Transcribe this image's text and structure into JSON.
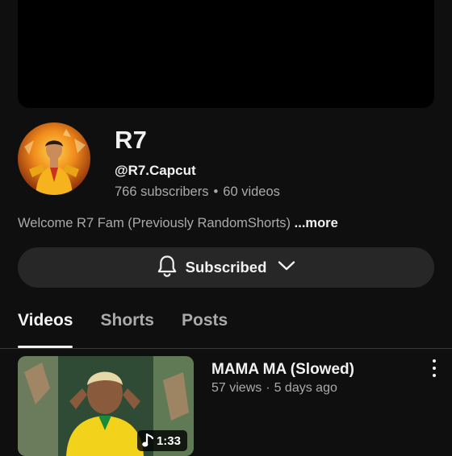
{
  "channel": {
    "name": "R7",
    "handle": "@R7.Capcut",
    "subscribers": "766 subscribers",
    "videos_count": "60 videos",
    "separator": "•",
    "description": "Welcome R7 Fam (Previously RandomShorts)",
    "more_label": "...more"
  },
  "subscribe": {
    "label": "Subscribed",
    "icon": "bell-icon",
    "dropdown_icon": "chevron-down-icon"
  },
  "tabs": [
    {
      "label": "Videos",
      "active": true
    },
    {
      "label": "Shorts",
      "active": false
    },
    {
      "label": "Posts",
      "active": false
    }
  ],
  "videos": [
    {
      "title": "MAMA MA (Slowed)",
      "views": "57 views",
      "separator": "·",
      "age": "5 days ago",
      "duration": "1:33",
      "duration_icon": "music-note-icon"
    }
  ],
  "colors": {
    "background": "#0f0f0f",
    "banner": "#000000",
    "button_bg": "#272727",
    "text_primary": "#f1f1f1",
    "text_secondary": "#aaaaaa"
  }
}
